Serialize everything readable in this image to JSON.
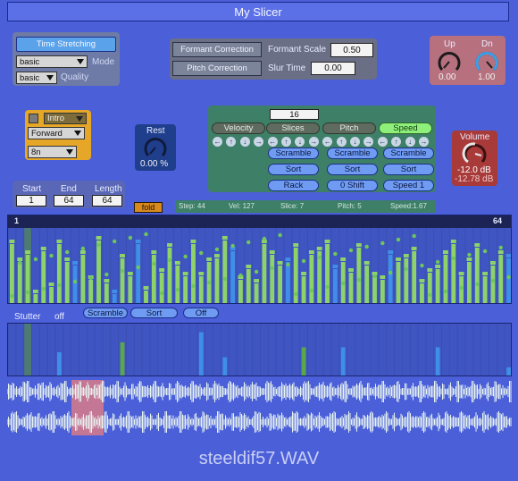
{
  "title": "My Slicer",
  "left_panel": {
    "time_stretch_label": "Time Stretching",
    "mode_value": "basic",
    "mode_label": "Mode",
    "quality_value": "basic",
    "quality_label": "Quality"
  },
  "formant": {
    "correction_label": "Formant Correction",
    "scale_label": "Formant Scale",
    "scale_value": "0.50",
    "pitch_correction_label": "Pitch Correction",
    "slur_label": "Slur Time",
    "slur_value": "0.00"
  },
  "updn": {
    "up_label": "Up",
    "dn_label": "Dn",
    "up_value": "0.00",
    "dn_value": "1.00"
  },
  "sequence": {
    "pattern_value": "Intro",
    "direction_value": "Forward",
    "rate_value": "8n"
  },
  "rest": {
    "label": "Rest",
    "value": "0.00 %"
  },
  "range": {
    "start_label": "Start",
    "end_label": "End",
    "length_label": "Length",
    "start_value": "1",
    "end_value": "64",
    "length_value": "64",
    "fold_label": "fold"
  },
  "matrix": {
    "count_value": "16",
    "tabs": [
      "Velocity",
      "Slices",
      "Pitch",
      "Speed"
    ],
    "row1": [
      "Scramble",
      "Scramble",
      "Scramble"
    ],
    "row2": [
      "Sort",
      "Sort",
      "Sort"
    ],
    "row3": [
      "Rack",
      "0 Shift",
      "Speed 1"
    ]
  },
  "volume": {
    "label": "Volume",
    "value": "-12.0 dB",
    "sub_value": "-12.78 dB"
  },
  "status": {
    "step": "Step:  44",
    "vel": "Vel:  127",
    "slice": "Slice:  7",
    "pitch": "Pitch:  5",
    "speed": "Speed:1.67"
  },
  "seq_display": {
    "start_marker": "1",
    "end_marker": "64"
  },
  "stutter": {
    "label": "Stutter",
    "value": "off",
    "buttons": [
      "Scramble",
      "Sort",
      "Off"
    ]
  },
  "filename": "steeldif57.WAV",
  "colors": {
    "background": "#4a5fd8",
    "bar_green": "#8ed36a",
    "bar_blue": "#3f8ee8",
    "highlight_red": "#d97a8a",
    "panel_gray": "#6b6f86"
  },
  "chart_data": {
    "type": "bar",
    "steps": 64,
    "tall_values": [
      85,
      60,
      70,
      15,
      75,
      25,
      85,
      60,
      55,
      70,
      35,
      90,
      30,
      15,
      65,
      40,
      85,
      20,
      70,
      45,
      80,
      55,
      40,
      85,
      40,
      60,
      65,
      90,
      75,
      35,
      50,
      30,
      85,
      70,
      55,
      60,
      80,
      40,
      70,
      75,
      85,
      50,
      60,
      45,
      80,
      55,
      40,
      35,
      70,
      60,
      65,
      75,
      30,
      45,
      50,
      70,
      85,
      40,
      60,
      80,
      40,
      55,
      70,
      65
    ],
    "tall_colors": [
      "g",
      "g",
      "g",
      "g",
      "g",
      "g",
      "g",
      "g",
      "b",
      "g",
      "g",
      "g",
      "g",
      "b",
      "g",
      "g",
      "b",
      "g",
      "g",
      "g",
      "g",
      "g",
      "g",
      "g",
      "g",
      "g",
      "g",
      "g",
      "b",
      "g",
      "g",
      "g",
      "g",
      "g",
      "g",
      "b",
      "g",
      "g",
      "g",
      "g",
      "g",
      "b",
      "g",
      "g",
      "g",
      "g",
      "g",
      "g",
      "b",
      "g",
      "g",
      "g",
      "g",
      "g",
      "g",
      "g",
      "g",
      "g",
      "g",
      "g",
      "g",
      "g",
      "g",
      "b"
    ],
    "stutter_values": [
      0,
      0,
      0,
      0,
      0,
      0,
      50,
      0,
      0,
      0,
      0,
      0,
      0,
      0,
      70,
      0,
      0,
      0,
      0,
      0,
      0,
      0,
      0,
      0,
      90,
      0,
      0,
      40,
      0,
      0,
      0,
      0,
      0,
      0,
      0,
      0,
      0,
      60,
      0,
      0,
      0,
      0,
      60,
      0,
      0,
      0,
      0,
      0,
      0,
      0,
      0,
      0,
      0,
      0,
      60,
      0,
      0,
      0,
      0,
      0,
      0,
      0,
      0,
      20
    ]
  }
}
